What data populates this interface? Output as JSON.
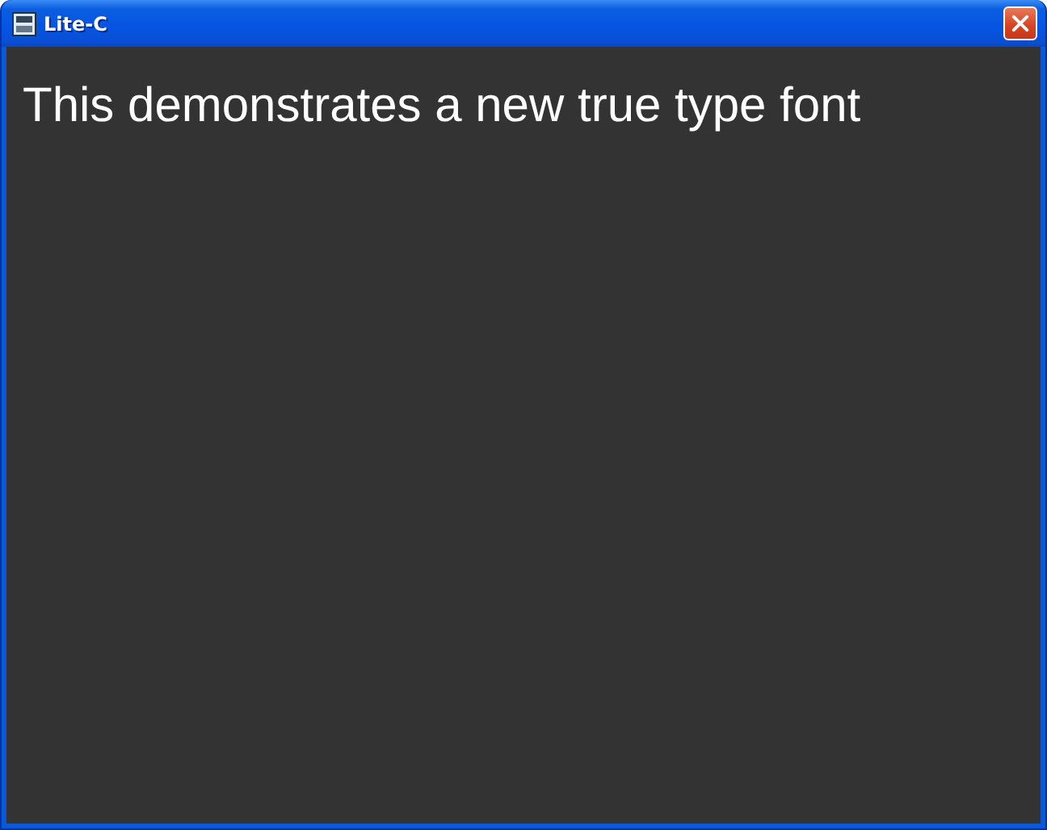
{
  "window": {
    "title": "Lite-C"
  },
  "content": {
    "text": "This demonstrates a new true type font"
  }
}
